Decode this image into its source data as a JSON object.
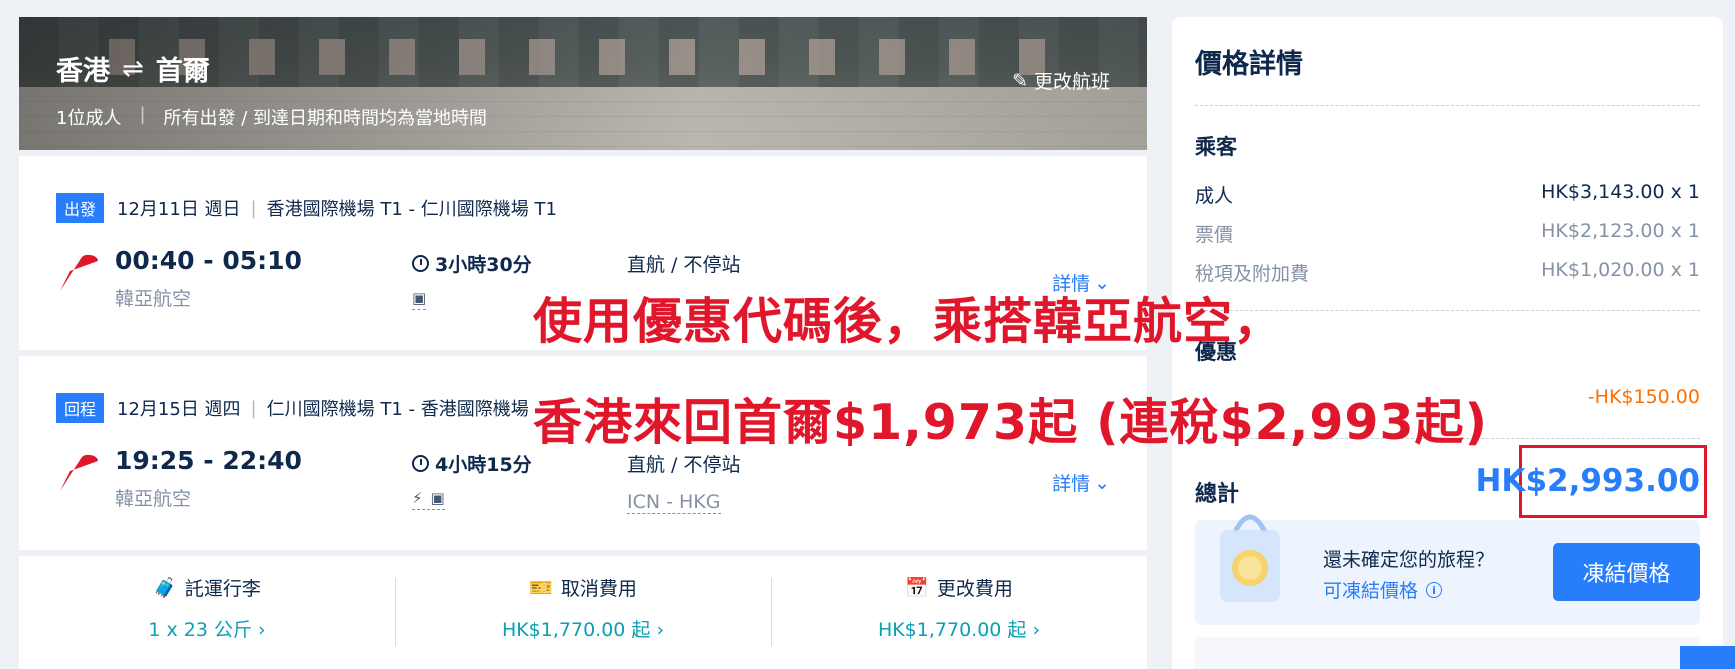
{
  "hero": {
    "from": "香港",
    "to": "首爾",
    "swap_icon": "⇌",
    "passengers": "1位成人",
    "sep": "|",
    "timezone_note": "所有出發 / 到達日期和時間均為當地時間",
    "change_flight": "更改航班",
    "edit_icon": "✎"
  },
  "outbound": {
    "badge": "出發",
    "date": "12月11日 週日",
    "route": "香港國際機場 T1 - 仁川國際機場 T1",
    "times": "00:40 - 05:10",
    "airline": "韓亞航空",
    "duration": "3小時30分",
    "stops": "直航 / 不停站",
    "details": "詳情"
  },
  "return": {
    "badge": "回程",
    "date": "12月15日 週四",
    "route": "仁川國際機場 T1 - 香港國際機場",
    "times": "19:25 - 22:40",
    "airline": "韓亞航空",
    "duration": "4小時15分",
    "stops": "直航 / 不停站",
    "airports": "ICN - HKG",
    "details": "詳情"
  },
  "fees": [
    {
      "title": "託運行李",
      "value": "1 x 23 公斤",
      "icon": "luggage-icon"
    },
    {
      "title": "取消費用",
      "value": "HK$1,770.00 起",
      "icon": "ticket-icon"
    },
    {
      "title": "更改費用",
      "value": "HK$1,770.00 起",
      "icon": "calendar-icon"
    }
  ],
  "overlay": {
    "line1": "使用優惠代碼後，乘搭韓亞航空，",
    "line2": "香港來回首爾$1,973起 (連稅$2,993起)"
  },
  "price": {
    "title": "價格詳情",
    "passengers_label": "乘客",
    "adult_label": "成人",
    "adult_value": "HK$3,143.00 x 1",
    "fare_label": "票價",
    "fare_value": "HK$2,123.00 x 1",
    "tax_label": "稅項及附加費",
    "tax_value": "HK$1,020.00 x 1",
    "discount_label": "優惠",
    "discount_value": "-HK$150.00",
    "total_label": "總計",
    "total_value": "HK$2,993.00",
    "freeze_question": "還未確定您的旅程？",
    "freeze_link": "可凍結價格",
    "freeze_button": "凍結價格"
  },
  "colors": {
    "accent": "#287dfa",
    "highlight": "#e0162b",
    "discount": "#ff6f00",
    "fee_link": "#0a9fb5"
  }
}
